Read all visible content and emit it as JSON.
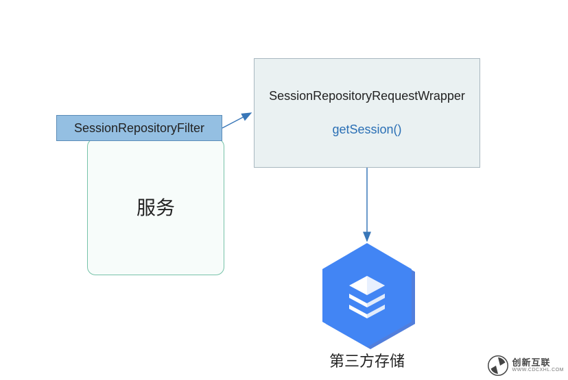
{
  "nodes": {
    "filter": {
      "label": "SessionRepositoryFilter"
    },
    "service": {
      "label": "服务"
    },
    "wrapper": {
      "label": "SessionRepositoryRequestWrapper",
      "method": "getSession()"
    },
    "storage": {
      "label": "第三方存储"
    }
  },
  "colors": {
    "filterBg": "#94bfe2",
    "filterBorder": "#5a8bb7",
    "serviceBorder": "#76c2a8",
    "serviceBg": "#f7fcfa",
    "wrapperBg": "#eaf1f2",
    "wrapperBorder": "#a8b7bf",
    "methodText": "#2a6fb5",
    "arrow": "#3977b8",
    "hexFill": "#4285f4",
    "hexShadow": "#3367d6",
    "iconLight": "#e8f0fe",
    "iconDark": "#c2d7f5"
  },
  "watermark": {
    "cn": "创新互联",
    "en": "WWW.CDCXHL.COM"
  },
  "edges": [
    {
      "from": "filter",
      "to": "wrapper"
    },
    {
      "from": "wrapper",
      "to": "storage"
    }
  ]
}
